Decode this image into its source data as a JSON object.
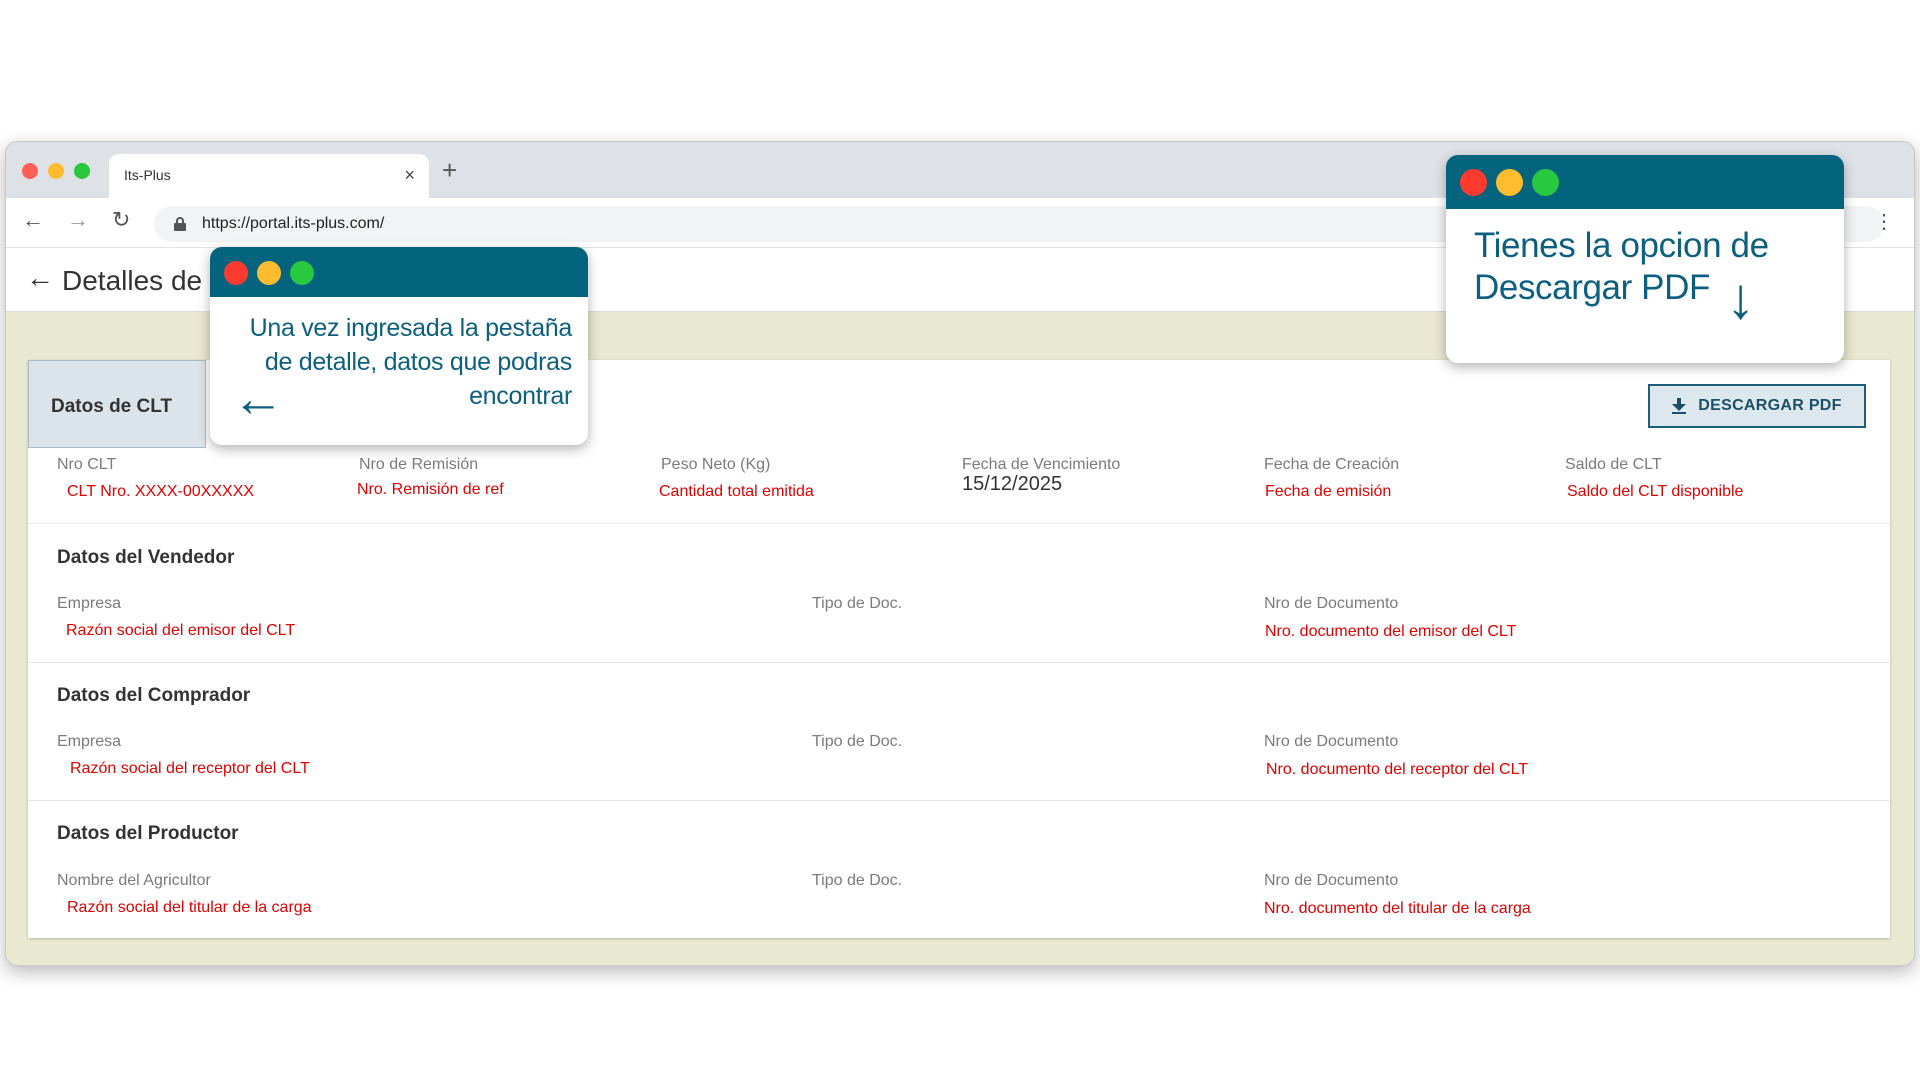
{
  "browser": {
    "tab_title": "Its-Plus",
    "tab_close": "×",
    "new_tab": "+",
    "url": "https://portal.its-plus.com/",
    "nav": {
      "back": "←",
      "forward": "→",
      "reload": "↻",
      "menu": "⋮"
    },
    "traffic_colors": [
      "#ff5f57",
      "#febc2e",
      "#28c840"
    ]
  },
  "header": {
    "back": "←",
    "title": "Detalles de"
  },
  "clt": {
    "tab_label": "Datos de CLT",
    "download_button": "DESCARGAR PDF",
    "fields": [
      {
        "label": "Nro CLT",
        "value": "CLT Nro. XXXX-00XXXXX"
      },
      {
        "label": "Nro de Remisión",
        "value": "Nro. Remisión de ref"
      },
      {
        "label": "Peso Neto (Kg)",
        "value": "Cantidad total emitida"
      },
      {
        "label": "Fecha de Vencimiento",
        "value": "15/12/2025"
      },
      {
        "label": "Fecha de Creación",
        "value": "Fecha de emisión"
      },
      {
        "label": "Saldo de CLT",
        "value": "Saldo del CLT disponible"
      }
    ]
  },
  "vendedor": {
    "title": "Datos del Vendedor",
    "empresa_label": "Empresa",
    "empresa_value": "Razón social del emisor del CLT",
    "tipo_label": "Tipo de Doc.",
    "doc_label": "Nro de Documento",
    "doc_value": "Nro. documento del emisor del CLT"
  },
  "comprador": {
    "title": "Datos del Comprador",
    "empresa_label": "Empresa",
    "empresa_value": "Razón social del receptor del CLT",
    "tipo_label": "Tipo de Doc.",
    "doc_label": "Nro de Documento",
    "doc_value": "Nro. documento del receptor del CLT"
  },
  "productor": {
    "title": "Datos del Productor",
    "nombre_label": "Nombre del Agricultor",
    "nombre_value": "Razón social del titular de la carga",
    "tipo_label": "Tipo de Doc.",
    "doc_label": "Nro de Documento",
    "doc_value": "Nro. documento del titular de la carga"
  },
  "callouts": {
    "detail": {
      "line1": "Una vez ingresada la pestaña",
      "line2": "de detalle, datos que podras",
      "line3": "encontrar",
      "arrow": "←"
    },
    "pdf": {
      "line1": "Tienes la opcion de",
      "line2": "Descargar PDF",
      "arrow": "↓"
    },
    "bar_color": "#04637d",
    "text_color": "#0d5f80"
  },
  "colors": {
    "accent": "#1d5f7a",
    "value_red": "#e00000",
    "page_bg": "#e9e8d0"
  }
}
